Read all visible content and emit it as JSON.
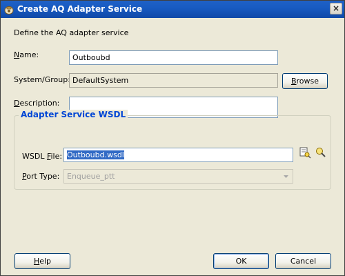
{
  "window": {
    "title": "Create AQ Adapter Service",
    "close_glyph": "×"
  },
  "form": {
    "intro": "Define the AQ adapter service",
    "name_label": "Name:",
    "name_value": "Outboubd",
    "system_label": "System/Group:",
    "system_value": "DefaultSystem",
    "browse_label": "Browse",
    "description_label": "Description:",
    "description_value": ""
  },
  "wsdl_group": {
    "title": "Adapter Service WSDL",
    "wsdl_label": "WSDL File:",
    "wsdl_value": "Outboubd.wsdl",
    "port_label": "Port Type:",
    "port_value": "Enqueue_ptt",
    "icons": [
      "browse-wsdl-icon",
      "edit-wsdl-icon"
    ]
  },
  "footer": {
    "help_label": "Help",
    "ok_label": "OK",
    "cancel_label": "Cancel"
  },
  "colors": {
    "title_bar": "#185bc2",
    "group_title": "#0046d5",
    "selection": "#316ac5"
  }
}
